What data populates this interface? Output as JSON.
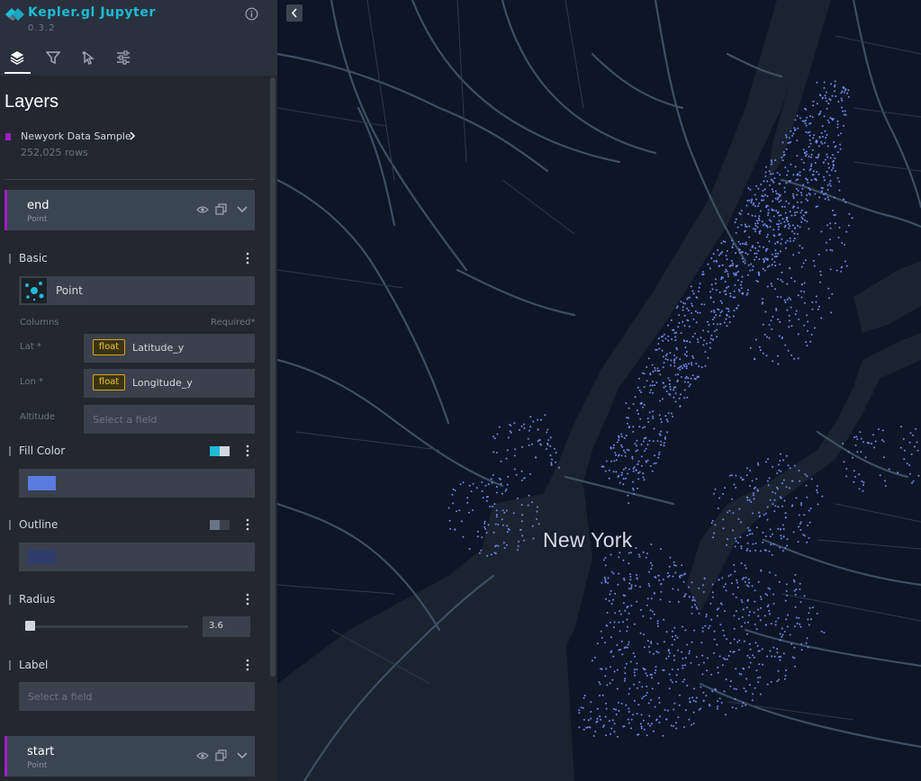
{
  "app": {
    "title": "Kepler.gl Jupyter",
    "version": "0.3.2"
  },
  "panel": {
    "title": "Layers"
  },
  "dataset": {
    "name": "Newyork Data Sample",
    "rows": "252,025 rows",
    "color": "#a01ec3"
  },
  "layers": [
    {
      "name": "end",
      "type": "Point",
      "visible": true
    },
    {
      "name": "start",
      "type": "Point",
      "visible": true
    }
  ],
  "config": {
    "basic_label": "Basic",
    "layer_type": "Point",
    "columns_label": "Columns",
    "required_label": "Required*",
    "columns": [
      {
        "label": "Lat *",
        "type": "float",
        "value": "Latitude_y"
      },
      {
        "label": "Lon *",
        "type": "float",
        "value": "Longitude_y"
      },
      {
        "label": "Altitude",
        "placeholder": "Select a field"
      }
    ],
    "fill_color_label": "Fill Color",
    "fill_color": "#5a7be0",
    "fill_color_enabled": true,
    "outline_label": "Outline",
    "outline_color": "#2f3d6e",
    "outline_enabled": false,
    "radius_label": "Radius",
    "radius_value": "3.6",
    "label_label": "Label",
    "label_placeholder": "Select a field"
  },
  "map": {
    "city_label": "New York",
    "point_color": "#6f88ef",
    "road_color": "#3d5066",
    "water_color": "#1b2532",
    "land_color": "#0e1726"
  },
  "icons": {
    "logo": "kepler-diamond-icon",
    "info": "info-icon",
    "tabs": [
      "layers-icon",
      "filter-icon",
      "interaction-icon",
      "settings-icon"
    ],
    "collapse": "chevron-left-icon"
  }
}
